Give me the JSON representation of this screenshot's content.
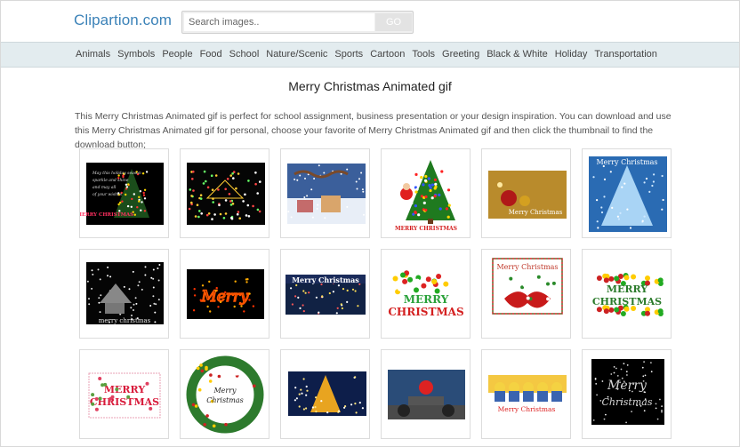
{
  "site": {
    "logo": "Clipartion.com"
  },
  "search": {
    "placeholder": "Search images..",
    "button": "GO"
  },
  "nav": [
    "Animals",
    "Symbols",
    "People",
    "Food",
    "School",
    "Nature/Scenic",
    "Sports",
    "Cartoon",
    "Tools",
    "Greeting",
    "Black & White",
    "Holiday",
    "Transportation"
  ],
  "page": {
    "title": "Merry Christmas Animated gif",
    "description": "This Merry Christmas Animated gif is perfect for school assignment, business presentation or your design inspiration. You can download and use this Merry Christmas Animated gif for personal, choose your favorite of Merry Christmas Animated gif and then click the thumbnail to find the download button;"
  },
  "thumbnails": [
    {
      "name": "thumb-christmas-tree-poem",
      "text": "MERRY CHRISTMAS"
    },
    {
      "name": "thumb-lit-house-night",
      "text": ""
    },
    {
      "name": "thumb-santa-sleigh-snow-village",
      "text": ""
    },
    {
      "name": "thumb-santa-christmas-tree",
      "text": "MERRY CHRISTMAS"
    },
    {
      "name": "thumb-gold-ornaments",
      "text": "Merry Christmas"
    },
    {
      "name": "thumb-blue-tree",
      "text": "Merry Christmas"
    },
    {
      "name": "thumb-snowy-village",
      "text": "merry christmas"
    },
    {
      "name": "thumb-neon-lights-text",
      "text": "Merry Christmas"
    },
    {
      "name": "thumb-night-scene-banner",
      "text": "Merry Christmas"
    },
    {
      "name": "thumb-ornament-wreath-text",
      "text": "MERRY CHRISTMAS"
    },
    {
      "name": "thumb-bow-frame",
      "text": "Merry Christmas"
    },
    {
      "name": "thumb-garland-text",
      "text": "MERRY CHRISTMAS"
    },
    {
      "name": "thumb-floral-text",
      "text": "MERRY CHRISTMAS"
    },
    {
      "name": "thumb-wreath",
      "text": "Merry Christmas"
    },
    {
      "name": "thumb-golden-tree-night",
      "text": ""
    },
    {
      "name": "thumb-santa-motorcycle",
      "text": ""
    },
    {
      "name": "thumb-minions-reindeer",
      "text": "Merry Christmas"
    },
    {
      "name": "thumb-sparkle-script",
      "text": "Merry Christmas"
    }
  ],
  "colors": {
    "brand": "#3b82b8",
    "navbar": "#e3ecef"
  }
}
